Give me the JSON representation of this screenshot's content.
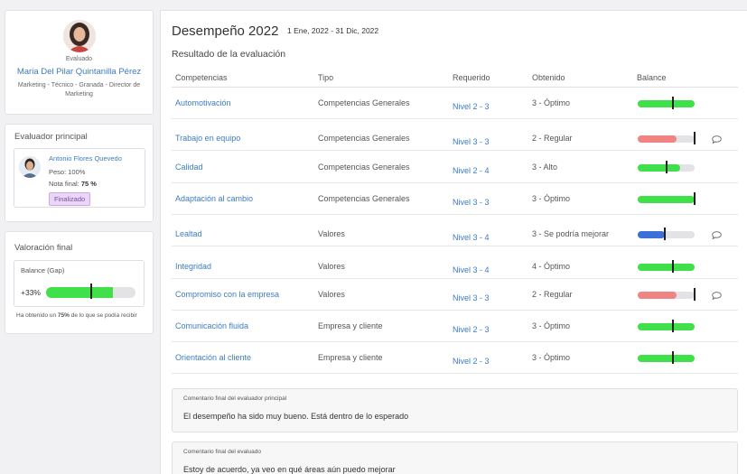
{
  "evaluado": {
    "label": "Evaluado",
    "name": "Maria Del Pilar Quintanilla Pérez",
    "role": "Marketing - Técnico - Granada - Director de Marketing"
  },
  "evaluador": {
    "title": "Evaluador principal",
    "name": "Antonio Flores Quevedo",
    "peso": "Peso: 100%",
    "nota_label": "Nota final:",
    "nota_value": "75 %",
    "status": "Finalizado"
  },
  "valoracion": {
    "title": "Valoración final",
    "gap_label": "Balance (Gap)",
    "gap_value": "+33%",
    "gap_fill": 0.75,
    "gap_marker": 0.5,
    "note_pre": "Ha obtenido un ",
    "note_bold": "75%",
    "note_post": " de lo que se podía recibir"
  },
  "main": {
    "title": "Desempeño 2022",
    "dates": "1 Ene, 2022 - 31 Dic, 2022",
    "subtitle": "Resultado de la evaluación"
  },
  "table": {
    "headers": {
      "competencias": "Competencias",
      "tipo": "Tipo",
      "requerido": "Requerido",
      "obtenido": "Obtenido",
      "balance": "Balance"
    },
    "rows": [
      {
        "competencia": "Automotivación",
        "tipo": "Competencias Generales",
        "requerido": "Nivel 2 - 3",
        "obtenido": "3 - Óptimo",
        "fill": 1.0,
        "marker": 0.62,
        "color": "#3fe049",
        "comment": false
      },
      {
        "competencia": "Trabajo en equipo",
        "tipo": "Competencias Generales",
        "requerido": "Nivel 3 - 3",
        "obtenido": "2 - Regular",
        "fill": 0.68,
        "marker": 1.0,
        "color": "#f28383",
        "comment": true
      },
      {
        "competencia": "Calidad",
        "tipo": "Competencias Generales",
        "requerido": "Nivel 2 - 4",
        "obtenido": "3 - Alto",
        "fill": 0.75,
        "marker": 0.5,
        "color": "#3fe049",
        "comment": false
      },
      {
        "competencia": "Adaptación al cambio",
        "tipo": "Competencias Generales",
        "requerido": "Nivel 3 - 3",
        "obtenido": "3 - Óptimo",
        "fill": 1.0,
        "marker": 1.0,
        "color": "#3fe049",
        "comment": false
      },
      {
        "competencia": "Lealtad",
        "tipo": "Valores",
        "requerido": "Nivel 3 - 4",
        "obtenido": "3 - Se podría mejorar",
        "fill": 0.47,
        "marker": 0.47,
        "color": "#3d6fd8",
        "comment": true
      },
      {
        "competencia": "Integridad",
        "tipo": "Valores",
        "requerido": "Nivel 3 - 4",
        "obtenido": "4 - Óptimo",
        "fill": 1.0,
        "marker": 0.62,
        "color": "#3fe049",
        "comment": false
      },
      {
        "competencia": "Compromiso con la empresa",
        "tipo": "Valores",
        "requerido": "Nivel 3 - 3",
        "obtenido": "2 - Regular",
        "fill": 0.68,
        "marker": 1.0,
        "color": "#f28383",
        "comment": true
      },
      {
        "competencia": "Comunicación fluida",
        "tipo": "Empresa y cliente",
        "requerido": "Nivel 2 - 3",
        "obtenido": "3 - Óptimo",
        "fill": 1.0,
        "marker": 0.62,
        "color": "#3fe049",
        "comment": false
      },
      {
        "competencia": "Orientación al cliente",
        "tipo": "Empresa y cliente",
        "requerido": "Nivel 2 - 3",
        "obtenido": "3 - Óptimo",
        "fill": 1.0,
        "marker": 0.62,
        "color": "#3fe049",
        "comment": false
      }
    ]
  },
  "comments": [
    {
      "label": "Comentario final del evaluador principal",
      "text": "El desempeño ha sido muy bueno. Está dentro de lo esperado"
    },
    {
      "label": "Comentario final del evaluado",
      "text": "Estoy de acuerdo, ya veo en qué áreas aún puedo mejorar"
    }
  ]
}
